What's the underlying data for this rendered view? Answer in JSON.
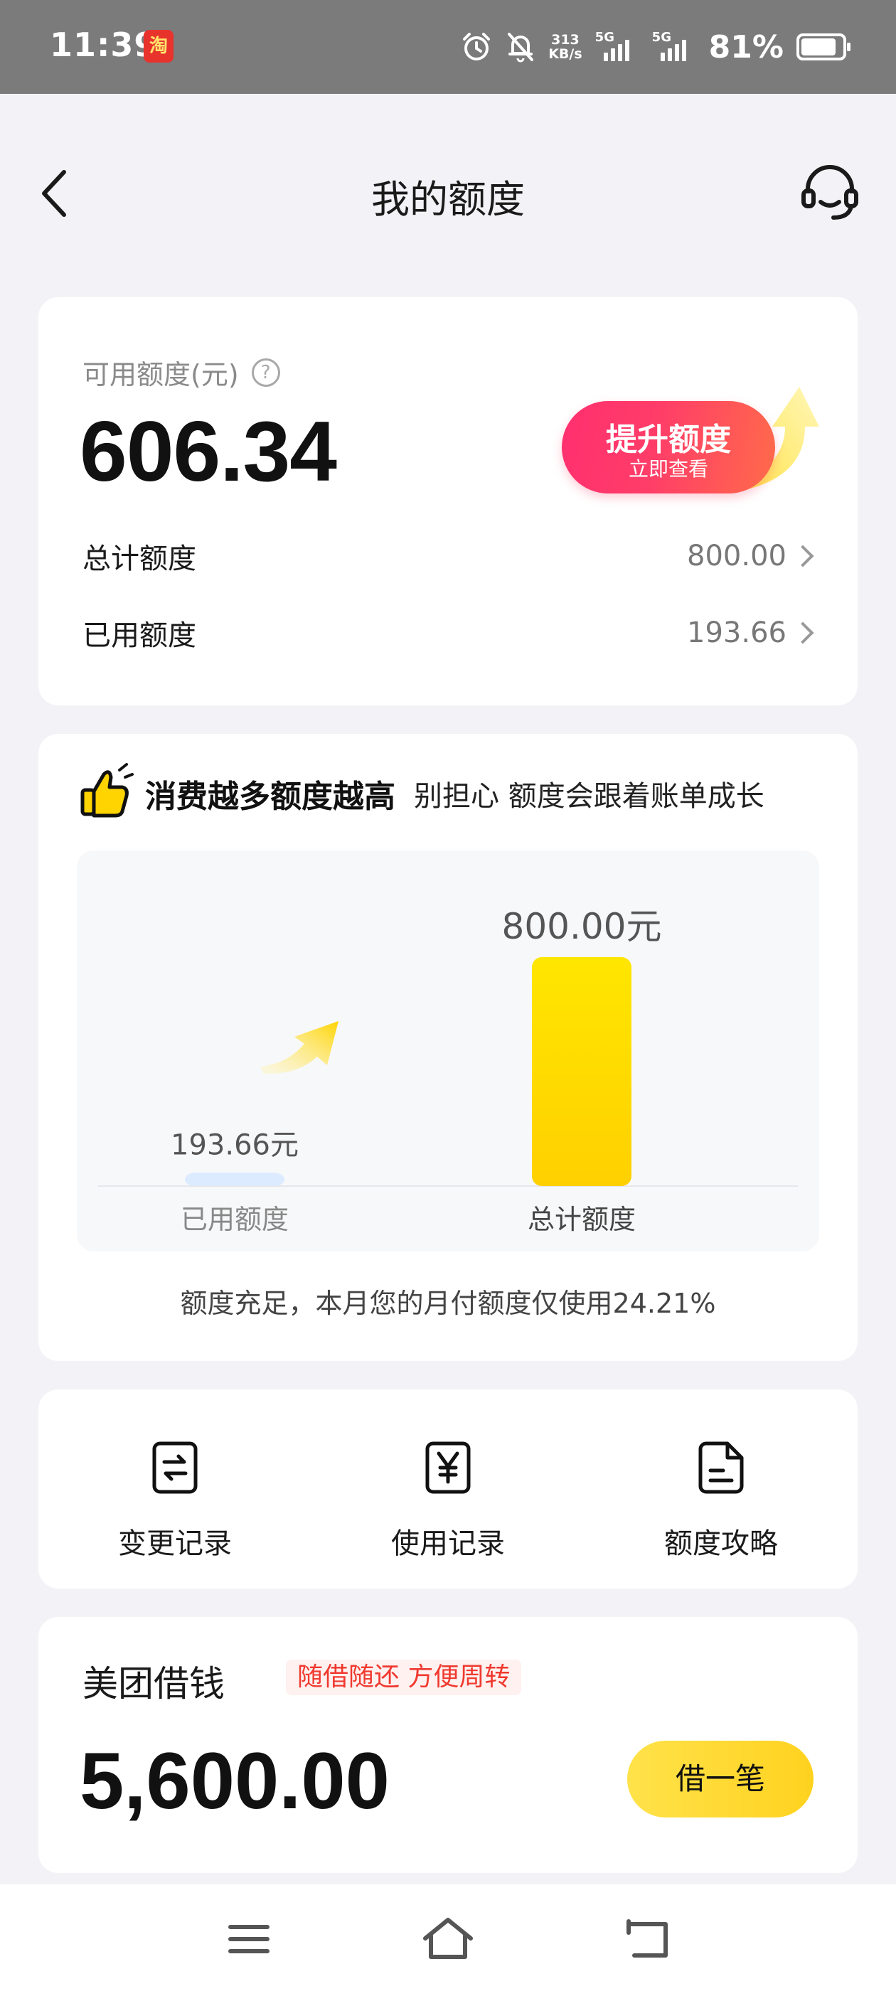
{
  "status_bar": {
    "time": "11:39",
    "app_icon_text": "淘",
    "net_speed_value": "313",
    "net_speed_unit": "KB/s",
    "signal1_label": "5G",
    "signal2_label": "5G",
    "battery_pct": "81%"
  },
  "header": {
    "title": "我的额度"
  },
  "quota": {
    "available_label": "可用额度(元)",
    "help_symbol": "?",
    "available_amount": "606.34",
    "raise_title": "提升额度",
    "raise_sub": "立即查看",
    "rows": [
      {
        "label": "总计额度",
        "value": "800.00"
      },
      {
        "label": "已用额度",
        "value": "193.66"
      }
    ]
  },
  "growth": {
    "title_part1": "消费越多",
    "title_part2": "额度越高",
    "desc": "别担心 额度会跟着账单成长",
    "note": "额度充足，本月您的月付额度仅使用24.21%"
  },
  "chart_data": {
    "type": "bar",
    "categories": [
      "已用额度",
      "总计额度"
    ],
    "values": [
      193.66,
      800.0
    ],
    "value_labels": [
      "193.66元",
      "800.00元"
    ],
    "unit": "元",
    "colors": [
      "#dcebff",
      "#ffd400"
    ],
    "title": "",
    "xlabel": "",
    "ylabel": ""
  },
  "actions": [
    {
      "label": "变更记录",
      "icon": "exchange-doc-icon"
    },
    {
      "label": "使用记录",
      "icon": "yuan-doc-icon"
    },
    {
      "label": "额度攻略",
      "icon": "guide-doc-icon"
    }
  ],
  "loan": {
    "title": "美团借钱",
    "badge": "随借随还 方便周转",
    "amount": "5,600.00",
    "button": "借一笔"
  },
  "colors": {
    "accent_yellow": "#ffd400",
    "raise_pink": "#ff2f6f",
    "badge_red": "#f0392f"
  }
}
